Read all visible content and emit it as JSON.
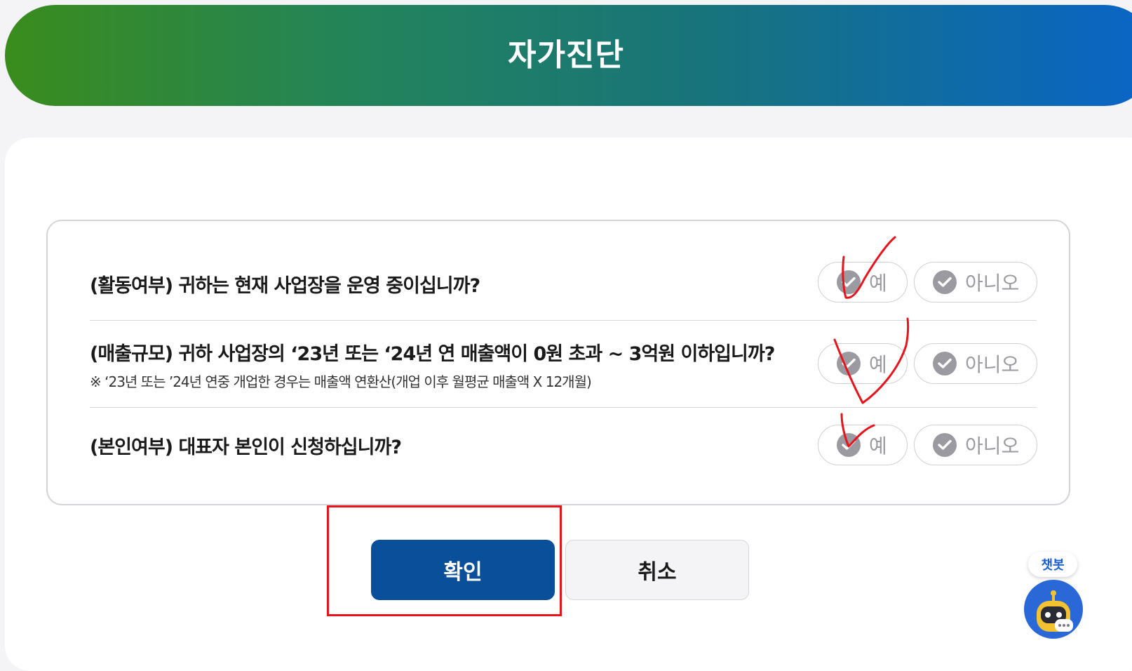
{
  "header": {
    "title": "자가진단"
  },
  "questions": [
    {
      "text": "(활동여부) 귀하는 현재 사업장을 운영 중이십니까?",
      "note": "",
      "yes_label": "예",
      "no_label": "아니오"
    },
    {
      "text": "(매출규모) 귀하 사업장의 ‘23년 또는 ‘24년 연 매출액이 0원 초과 ~ 3억원 이하입니까?",
      "note": "※ ‘23년 또는 ’24년 연중 개업한 경우는 매출액 연환산(개업 이후 월평균 매출액 X 12개월)",
      "yes_label": "예",
      "no_label": "아니오"
    },
    {
      "text": "(본인여부) 대표자 본인이 신청하십니까?",
      "note": "",
      "yes_label": "예",
      "no_label": "아니오"
    }
  ],
  "actions": {
    "confirm_label": "확인",
    "cancel_label": "취소"
  },
  "chatbot": {
    "label": "챗봇"
  },
  "colors": {
    "header_gradient_start": "#3a8c1c",
    "header_gradient_end": "#0a64c8",
    "confirm_button": "#0a4f9a",
    "annotation_red": "#e8141c",
    "option_gray": "#9a9aa0"
  },
  "icons": {
    "option_check": "check-circle-icon",
    "chatbot": "robot-chat-icon"
  },
  "annotations": {
    "handwritten_checks_on": [
      "question-1-yes",
      "question-2-yes",
      "question-3-yes"
    ],
    "highlight_box_on": "confirm-button"
  }
}
